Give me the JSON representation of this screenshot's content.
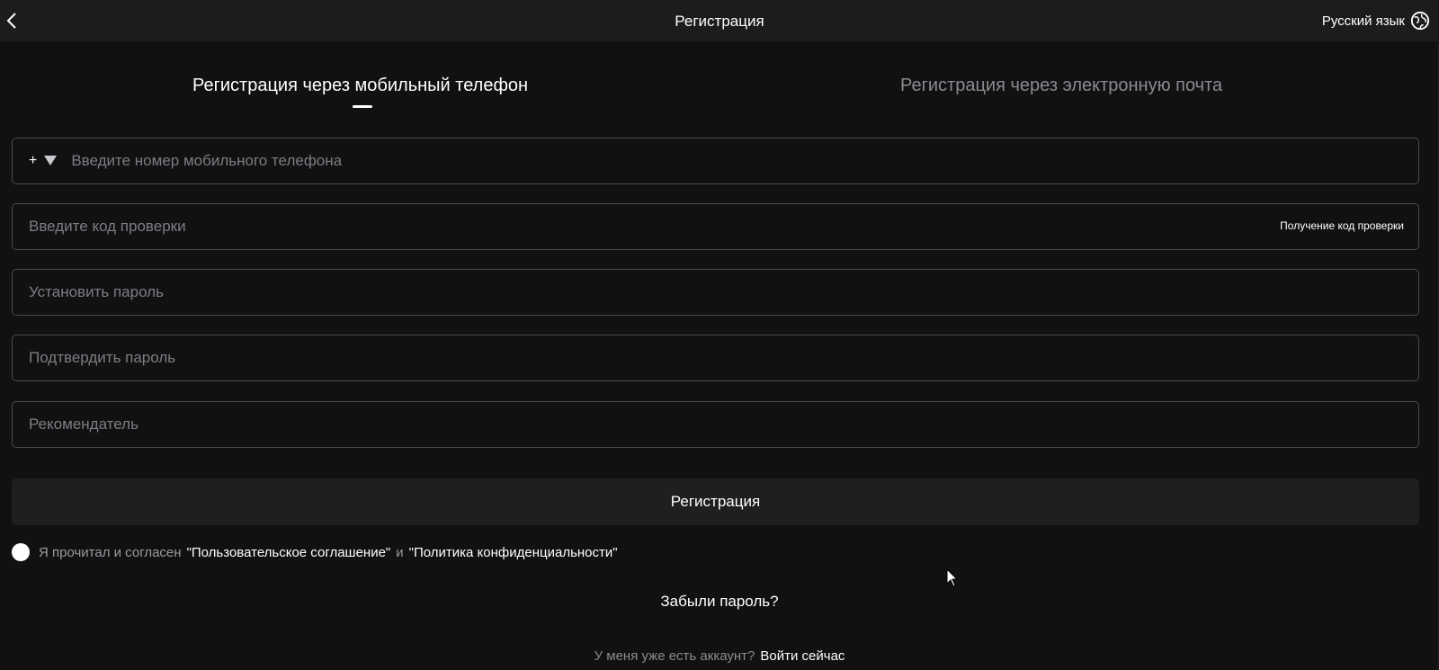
{
  "header": {
    "title": "Регистрация",
    "language": "Русский язык",
    "back_icon": "chevron-left-icon",
    "language_icon": "globe-icon"
  },
  "tabs": [
    {
      "label": "Регистрация через мобильный телефон",
      "active": true
    },
    {
      "label": "Регистрация через электронную почта",
      "active": false
    }
  ],
  "form": {
    "phone": {
      "prefix": "+",
      "placeholder": "Введите номер мобильного телефона",
      "value": ""
    },
    "code": {
      "placeholder": "Введите код проверки",
      "value": "",
      "action": "Получение код проверки"
    },
    "password": {
      "placeholder": "Установить пароль",
      "value": ""
    },
    "confirm": {
      "placeholder": "Подтвердить пароль",
      "value": ""
    },
    "referrer": {
      "placeholder": "Рекомендатель",
      "value": ""
    },
    "submit_label": "Регистрация"
  },
  "agreement": {
    "text": "Я прочитал и согласен",
    "terms": "\"Пользовательское соглашение\"",
    "and": "и",
    "privacy": "\"Политика конфиденциальности\"",
    "checked": false
  },
  "forgot_password": "Забыли пароль?",
  "login_prompt": {
    "text": "У меня уже есть аккаунт?",
    "link": "Войти сейчас"
  },
  "colors": {
    "background": "#111111",
    "header_bg": "#1c1c1c",
    "border": "#4a4a4a",
    "placeholder": "#7d7d86",
    "muted": "#8a8a93",
    "text": "#ffffff"
  }
}
